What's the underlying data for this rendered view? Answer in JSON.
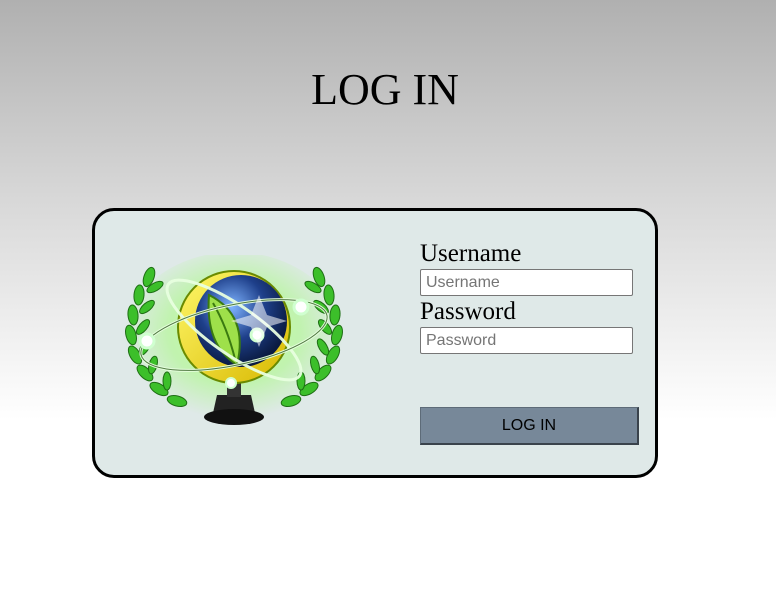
{
  "page": {
    "title": "LOG IN"
  },
  "form": {
    "username_label": "Username",
    "username_placeholder": "Username",
    "password_label": "Password",
    "password_placeholder": "Password",
    "submit_label": "LOG IN"
  },
  "logo": {
    "icon": "atom-globe-laurel-emblem",
    "colors": {
      "laurel": "#3cbf2a",
      "glow": "#9cff6a",
      "ring": "#f0e000",
      "globe": "#1e3f8a",
      "base": "#1a1a1a"
    }
  },
  "colors": {
    "card_background": "#dfe9e8",
    "card_border": "#000000",
    "button_background": "#778899"
  }
}
